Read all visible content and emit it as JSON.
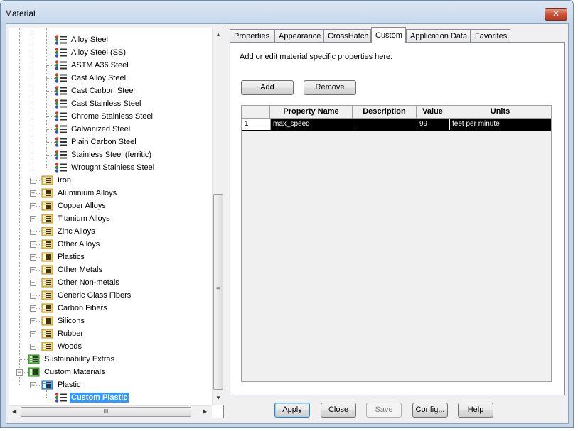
{
  "window": {
    "title": "Material",
    "close_glyph": "✕"
  },
  "tree": {
    "items": [
      {
        "label": "Alloy Steel",
        "depth": 2,
        "kind": "material"
      },
      {
        "label": "Alloy Steel (SS)",
        "depth": 2,
        "kind": "material"
      },
      {
        "label": "ASTM A36 Steel",
        "depth": 2,
        "kind": "material"
      },
      {
        "label": "Cast Alloy Steel",
        "depth": 2,
        "kind": "material"
      },
      {
        "label": "Cast Carbon Steel",
        "depth": 2,
        "kind": "material"
      },
      {
        "label": "Cast Stainless Steel",
        "depth": 2,
        "kind": "material"
      },
      {
        "label": "Chrome Stainless Steel",
        "depth": 2,
        "kind": "material"
      },
      {
        "label": "Galvanized Steel",
        "depth": 2,
        "kind": "material"
      },
      {
        "label": "Plain Carbon Steel",
        "depth": 2,
        "kind": "material"
      },
      {
        "label": "Stainless Steel (ferritic)",
        "depth": 2,
        "kind": "material"
      },
      {
        "label": "Wrought Stainless Steel",
        "depth": 2,
        "kind": "material"
      },
      {
        "label": "Iron",
        "depth": 1,
        "kind": "folder",
        "expander": "+"
      },
      {
        "label": "Aluminium Alloys",
        "depth": 1,
        "kind": "folder",
        "expander": "+"
      },
      {
        "label": "Copper Alloys",
        "depth": 1,
        "kind": "folder",
        "expander": "+"
      },
      {
        "label": "Titanium Alloys",
        "depth": 1,
        "kind": "folder",
        "expander": "+"
      },
      {
        "label": "Zinc Alloys",
        "depth": 1,
        "kind": "folder",
        "expander": "+"
      },
      {
        "label": "Other Alloys",
        "depth": 1,
        "kind": "folder",
        "expander": "+"
      },
      {
        "label": "Plastics",
        "depth": 1,
        "kind": "folder",
        "expander": "+"
      },
      {
        "label": "Other Metals",
        "depth": 1,
        "kind": "folder",
        "expander": "+"
      },
      {
        "label": "Other Non-metals",
        "depth": 1,
        "kind": "folder",
        "expander": "+"
      },
      {
        "label": "Generic Glass Fibers",
        "depth": 1,
        "kind": "folder",
        "expander": "+"
      },
      {
        "label": "Carbon Fibers",
        "depth": 1,
        "kind": "folder",
        "expander": "+"
      },
      {
        "label": "Silicons",
        "depth": 1,
        "kind": "folder",
        "expander": "+"
      },
      {
        "label": "Rubber",
        "depth": 1,
        "kind": "folder",
        "expander": "+"
      },
      {
        "label": "Woods",
        "depth": 1,
        "kind": "folder",
        "expander": "+"
      },
      {
        "label": "Sustainability Extras",
        "depth": 0,
        "kind": "library"
      },
      {
        "label": "Custom Materials",
        "depth": 0,
        "kind": "library",
        "expander": "−"
      },
      {
        "label": "Plastic",
        "depth": 1,
        "kind": "category",
        "expander": "−"
      },
      {
        "label": "Custom Plastic",
        "depth": 2,
        "kind": "material",
        "selected": true
      }
    ],
    "hscroll_grip": "III",
    "vscroll_grip": "≡"
  },
  "tabs": [
    {
      "label": "Properties",
      "active": false
    },
    {
      "label": "Appearance",
      "active": false
    },
    {
      "label": "CrossHatch",
      "active": false
    },
    {
      "label": "Custom",
      "active": true
    },
    {
      "label": "Application Data",
      "active": false
    },
    {
      "label": "Favorites",
      "active": false
    }
  ],
  "custom_tab": {
    "hint": "Add or edit material specific properties here:",
    "add_label": "Add",
    "remove_label": "Remove",
    "columns": [
      "",
      "Property Name",
      "Description",
      "Value",
      "Units"
    ],
    "rows": [
      {
        "index": "1",
        "property_name": "max_speed",
        "description": "",
        "value": "99",
        "units": "feet per minute"
      }
    ]
  },
  "footer": {
    "apply_label": "Apply",
    "close_label": "Close",
    "save_label": "Save",
    "config_label": "Config...",
    "help_label": "Help"
  },
  "colors": {
    "selection": "#3399ff",
    "frame": "#c5d6ea",
    "close_button": "#c74f34"
  }
}
